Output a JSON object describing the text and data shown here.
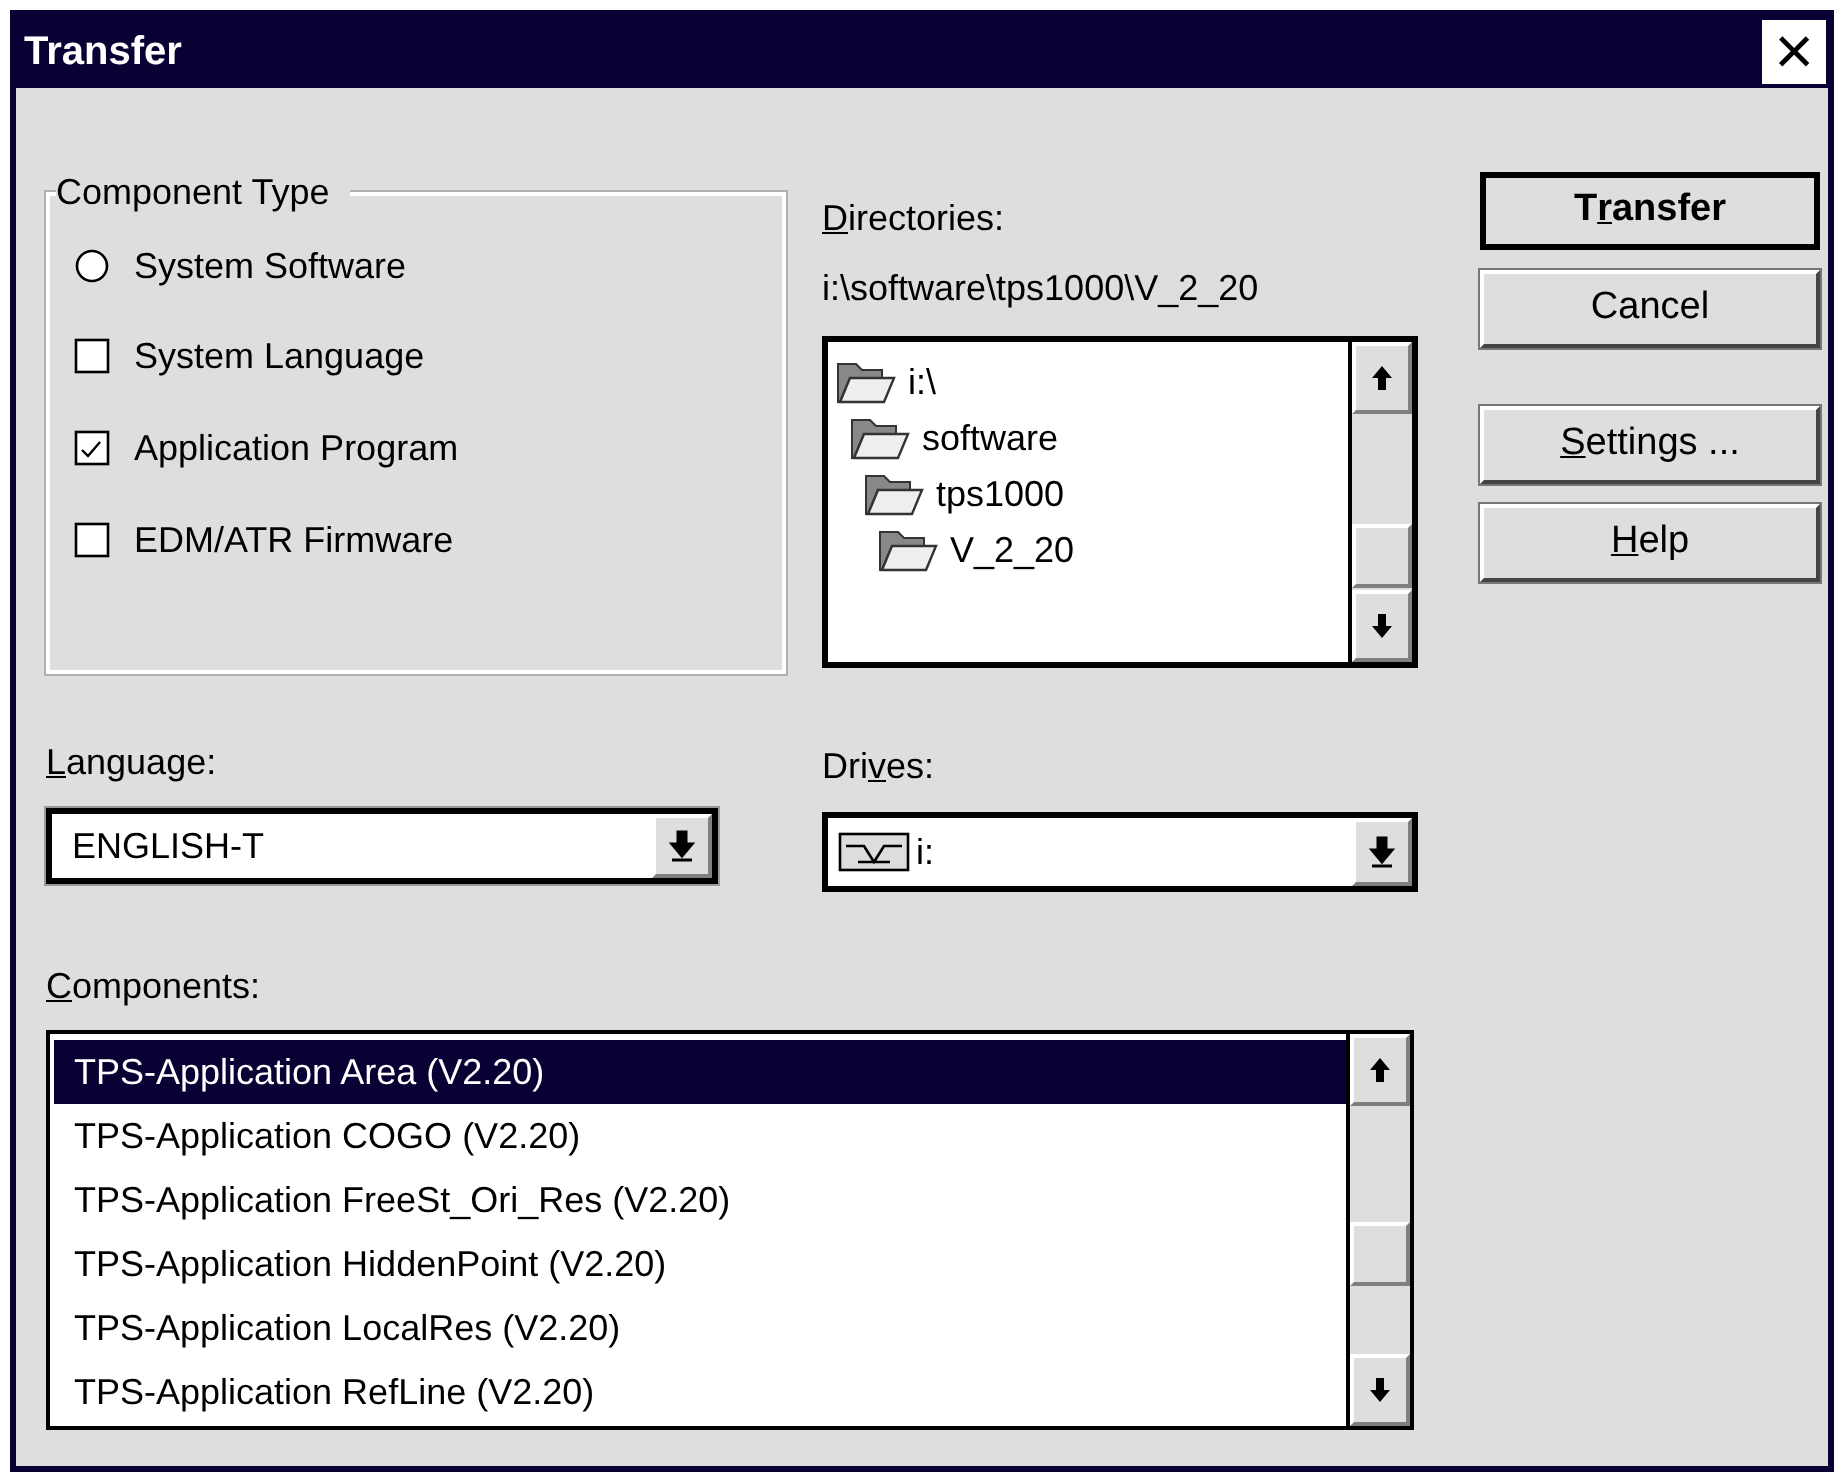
{
  "window": {
    "title": "Transfer",
    "close": "×"
  },
  "component_type": {
    "title": "Component Type",
    "options": [
      {
        "kind": "radio",
        "label": "System Software",
        "checked": false
      },
      {
        "kind": "checkbox",
        "label": "System Language",
        "checked": false
      },
      {
        "kind": "checkbox",
        "label": "Application Program",
        "checked": true
      },
      {
        "kind": "checkbox",
        "label": "EDM/ATR Firmware",
        "checked": false
      }
    ]
  },
  "directories": {
    "label": [
      {
        "text": "D",
        "underline": true
      },
      {
        "text": "irectories:",
        "underline": false
      }
    ],
    "path": "i:\\software\\tps1000\\V_2_20",
    "tree": [
      {
        "label": "i:\\",
        "children": [
          {
            "label": "software",
            "children": [
              {
                "label": "tps1000",
                "children": [
                  {
                    "label": "V_2_20"
                  }
                ]
              }
            ]
          }
        ]
      }
    ]
  },
  "buttons": [
    {
      "default": true,
      "label": [
        {
          "text": "T",
          "underline": false
        },
        {
          "text": "r",
          "underline": true
        },
        {
          "text": "ansfer",
          "underline": false
        }
      ]
    },
    {
      "default": false,
      "label": [
        {
          "text": "Cancel",
          "underline": false
        }
      ]
    },
    {
      "default": false,
      "label": [
        {
          "text": "S",
          "underline": true
        },
        {
          "text": "ettings ...",
          "underline": false
        }
      ]
    },
    {
      "default": false,
      "label": [
        {
          "text": "H",
          "underline": true
        },
        {
          "text": "elp",
          "underline": false
        }
      ]
    }
  ],
  "language": {
    "label": [
      {
        "text": "L",
        "underline": true
      },
      {
        "text": "anguage:",
        "underline": false
      }
    ],
    "value": "ENGLISH-T"
  },
  "drives": {
    "label": [
      {
        "text": "Dri",
        "underline": false
      },
      {
        "text": "v",
        "underline": true
      },
      {
        "text": "es:",
        "underline": false
      }
    ],
    "value": "i:"
  },
  "components": {
    "label": [
      {
        "text": "C",
        "underline": true
      },
      {
        "text": "omponents:",
        "underline": false
      }
    ],
    "items": [
      {
        "label": "TPS-Application Area (V2.20)",
        "selected": true
      },
      {
        "label": "TPS-Application COGO (V2.20)",
        "selected": false
      },
      {
        "label": "TPS-Application FreeSt_Ori_Res (V2.20)",
        "selected": false
      },
      {
        "label": "TPS-Application HiddenPoint (V2.20)",
        "selected": false
      },
      {
        "label": "TPS-Application LocalRes (V2.20)",
        "selected": false
      },
      {
        "label": "TPS-Application RefLine (V2.20)",
        "selected": false
      }
    ]
  }
}
